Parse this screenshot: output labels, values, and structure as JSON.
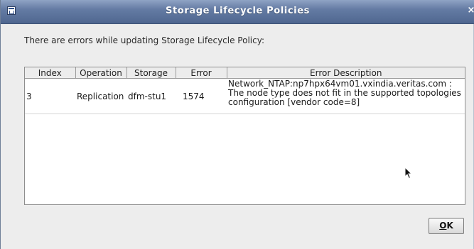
{
  "window": {
    "title": "Storage Lifecycle Policies",
    "close_glyph": "×"
  },
  "message": "There are errors while updating Storage Lifecycle Policy:",
  "table": {
    "columns": [
      "Index",
      "Operation",
      "Storage",
      "Error",
      "Error Description"
    ],
    "rows": [
      {
        "index": "3",
        "operation": "Replication",
        "storage": "dfm-stu1",
        "error": "1574",
        "description": "Network_NTAP:np7hpx64vm01.vxindia.veritas.com : The node type does not fit in the supported topologies configuration [vendor code=8]"
      }
    ]
  },
  "buttons": {
    "ok_mnemonic": "O",
    "ok_rest": "K"
  },
  "icons": {
    "app": "window-app-icon",
    "close": "close-icon",
    "cursor": "mouse-pointer-icon"
  },
  "colors": {
    "titlebar": "#647ba3",
    "window_bg": "#ededed",
    "table_bg": "#ffffff"
  }
}
